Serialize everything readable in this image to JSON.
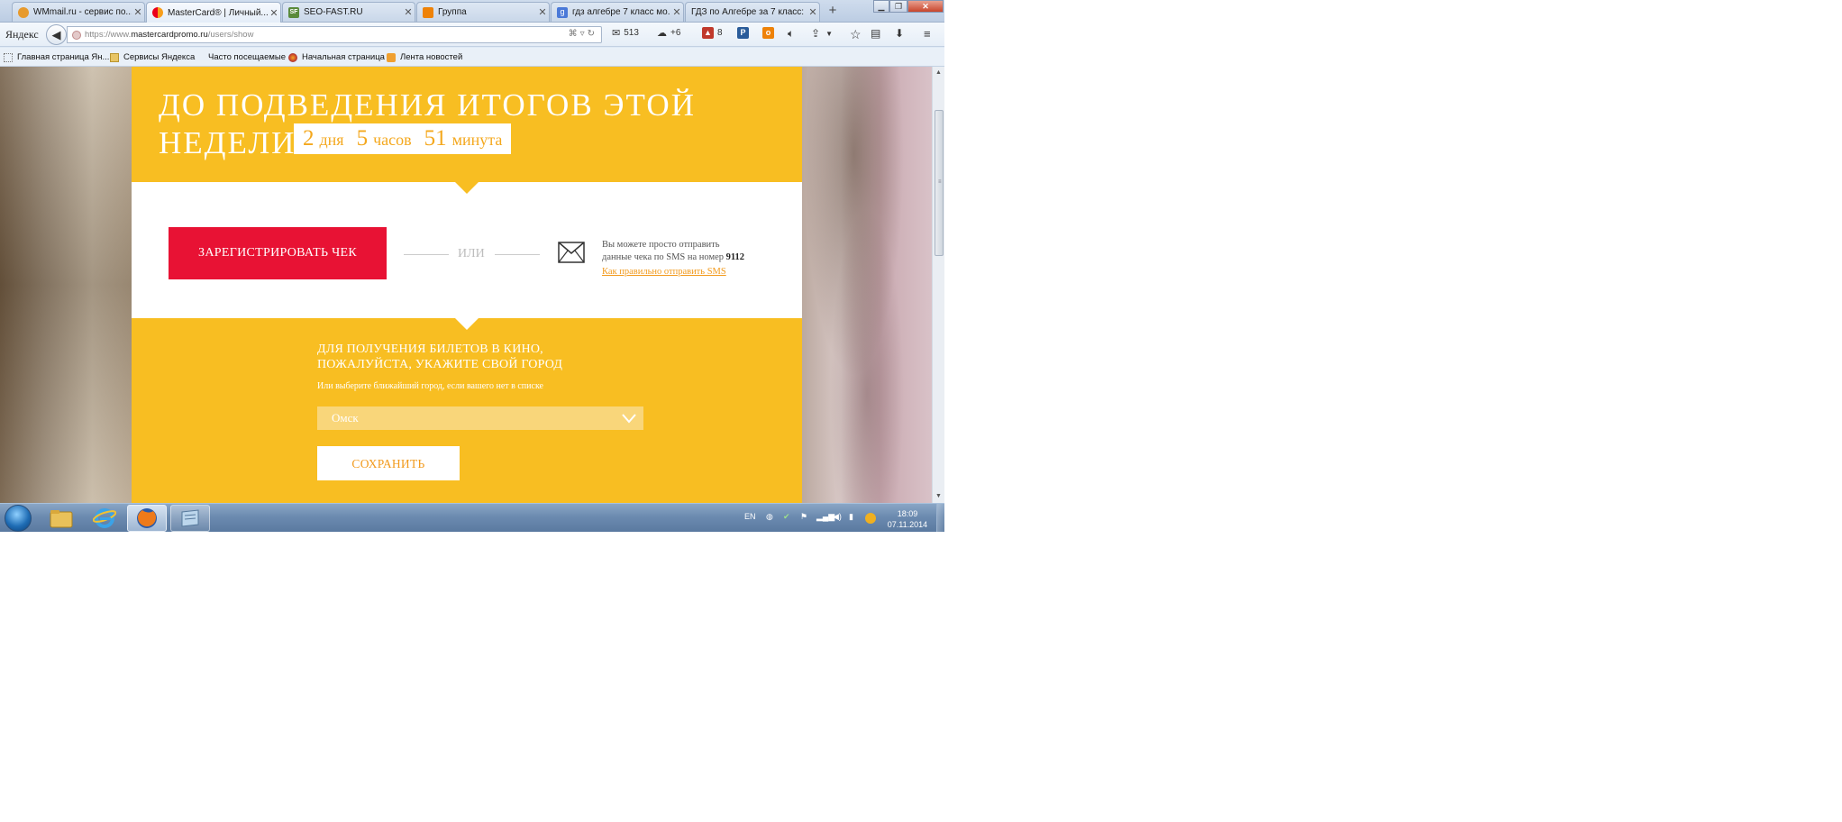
{
  "browser": {
    "tabs": [
      {
        "title": "WMmail.ru - сервис по...",
        "favicon_color": "#e79a2d"
      },
      {
        "title": "MasterCard® | Личный...",
        "favicon_color": "#eb001b",
        "active": true
      },
      {
        "title": "SEO-FAST.RU",
        "favicon_text": "SF",
        "favicon_color": "#5a8a3a"
      },
      {
        "title": "Группа",
        "favicon_color": "#ee8208"
      },
      {
        "title": "гдз алгебре 7 класс мо...",
        "favicon_text": "g",
        "favicon_color": "#4a79d8"
      },
      {
        "title": "ГДЗ по Алгебре за 7 класс: ...",
        "favicon_color": "#ffffff"
      }
    ],
    "new_tab_label": "+",
    "brand": "Яндекс",
    "url_prefix": "https://www.",
    "url_host": "mastercardpromo.ru",
    "url_path": "/users/show",
    "toolbar": {
      "mail_count": "513",
      "weather": "+6",
      "notifications": "8"
    },
    "bookmarks": [
      {
        "label": "Главная страница Ян..."
      },
      {
        "label": "Сервисы Яндекса"
      },
      {
        "label": "Часто посещаемые"
      },
      {
        "label": "Начальная страница"
      },
      {
        "label": "Лента новостей"
      }
    ]
  },
  "page": {
    "headline_line1": "ДО ПОДВЕДЕНИЯ ИТОГОВ ЭТОЙ",
    "headline_line2": "НЕДЕЛИ",
    "countdown": {
      "days_value": "2",
      "days_unit": "дня",
      "hours_value": "5",
      "hours_unit": "часов",
      "minutes_value": "51",
      "minutes_unit": "минута"
    },
    "register_button": "ЗАРЕГИСТРИРОВАТЬ ЧЕК",
    "or_text": "ИЛИ",
    "sms_text_line1": "Вы можете просто отправить",
    "sms_text_line2": "данные чека по SMS на номер",
    "sms_number": "9112",
    "sms_link": "Как правильно отправить SMS",
    "city_heading_line1": "ДЛЯ ПОЛУЧЕНИЯ БИЛЕТОВ В КИНО,",
    "city_heading_line2": "ПОЖАЛУЙСТА, УКАЖИТЕ СВОЙ ГОРОД",
    "city_subtext": "Или выберите ближайший город, если вашего нет в списке",
    "city_selected": "Омск",
    "save_button": "СОХРАНИТЬ",
    "colors": {
      "yellow": "#f8be22",
      "red": "#e81234",
      "orange": "#f29a1c"
    }
  },
  "taskbar": {
    "language": "EN",
    "time": "18:09",
    "date": "07.11.2014"
  }
}
